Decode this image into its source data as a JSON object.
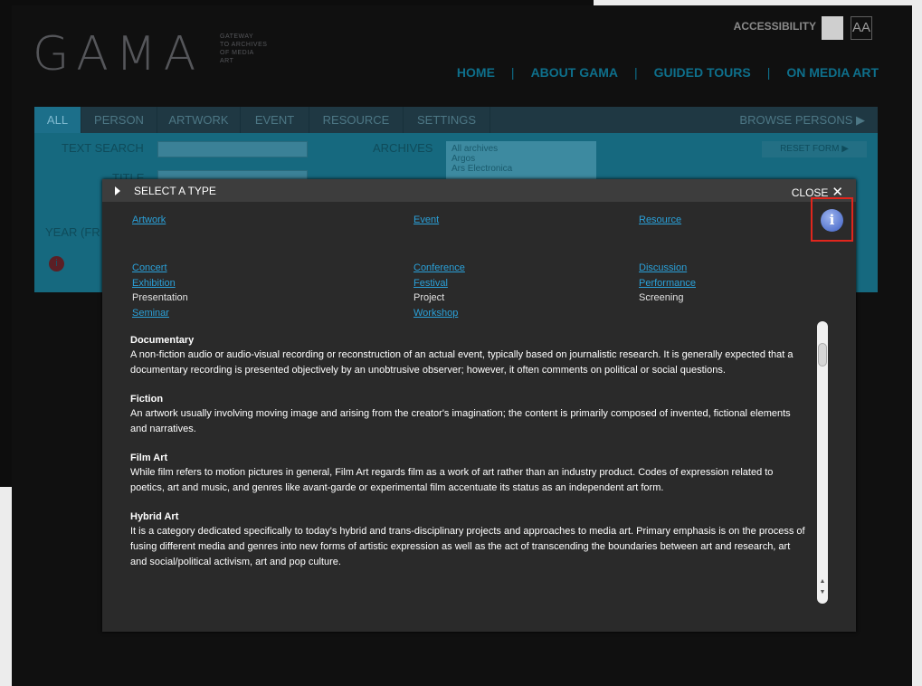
{
  "logo": {
    "text": "GAMA",
    "tagline": [
      "GATEWAY",
      "TO ARCHIVES",
      "OF MEDIA",
      "ART"
    ]
  },
  "accessibility": {
    "label": "ACCESSIBILITY",
    "font_toggle": "AA"
  },
  "nav": {
    "items": [
      "HOME",
      "ABOUT GAMA",
      "GUIDED TOURS",
      "ON MEDIA ART"
    ]
  },
  "tabs": {
    "items": [
      "ALL",
      "PERSON",
      "ARTWORK",
      "EVENT",
      "RESOURCE",
      "SETTINGS"
    ],
    "active": "ALL",
    "browse": "BROWSE PERSONS ▶"
  },
  "form": {
    "text_search_label": "TEXT SEARCH",
    "title_label": "TITLE",
    "archives_label": "ARCHIVES",
    "archives_options": [
      "All archives",
      "Argos",
      "Ars Electronica"
    ],
    "year_label": "YEAR (FR",
    "reset_label": "RESET FORM ▶"
  },
  "modal": {
    "title": "SELECT A TYPE",
    "close_label": "CLOSE",
    "close_icon": "✕",
    "primary": {
      "artwork": "Artwork",
      "event": "Event",
      "resource": "Resource"
    },
    "columns": {
      "col1": [
        {
          "label": "Concert",
          "linked": true
        },
        {
          "label": "Exhibition",
          "linked": true
        },
        {
          "label": "Presentation",
          "linked": false
        },
        {
          "label": "Seminar",
          "linked": true
        }
      ],
      "col2": [
        {
          "label": "Conference",
          "linked": true
        },
        {
          "label": "Festival",
          "linked": true
        },
        {
          "label": "Project",
          "linked": false
        },
        {
          "label": "Workshop",
          "linked": true
        }
      ],
      "col3": [
        {
          "label": "Discussion",
          "linked": true
        },
        {
          "label": "Performance",
          "linked": true
        },
        {
          "label": "Screening",
          "linked": false
        }
      ]
    },
    "info_icon_glyph": "i",
    "definitions": [
      {
        "term": "Documentary",
        "text": "A non-fiction audio or audio-visual recording or reconstruction of an actual event, typically based on journalistic research. It is generally expected that a documentary recording is presented objectively by an unobtrusive observer; however, it often comments on political or social questions."
      },
      {
        "term": "Fiction",
        "text": "An artwork usually involving moving image and arising from the creator's imagination; the content is primarily composed of invented, fictional elements and narratives."
      },
      {
        "term": "Film Art",
        "text": "While film refers to motion pictures in general, Film Art regards film as a work of art rather than an industry product. Codes of expression related to poetics, art and music, and genres like avant-garde or experimental film accentuate its status as an independent art form."
      },
      {
        "term": "Hybrid Art",
        "text": "It is a category dedicated specifically to today's hybrid and trans-disciplinary projects and approaches to media art. Primary emphasis is on the process of fusing different media and genres into new forms of artistic expression as well as the act of transcending the boundaries between art and research, art and social/political activism, art and pop culture."
      }
    ]
  },
  "colors": {
    "accent": "#2aa0d8",
    "highlight": "#e0261d",
    "panel": "#2a2a2a"
  }
}
